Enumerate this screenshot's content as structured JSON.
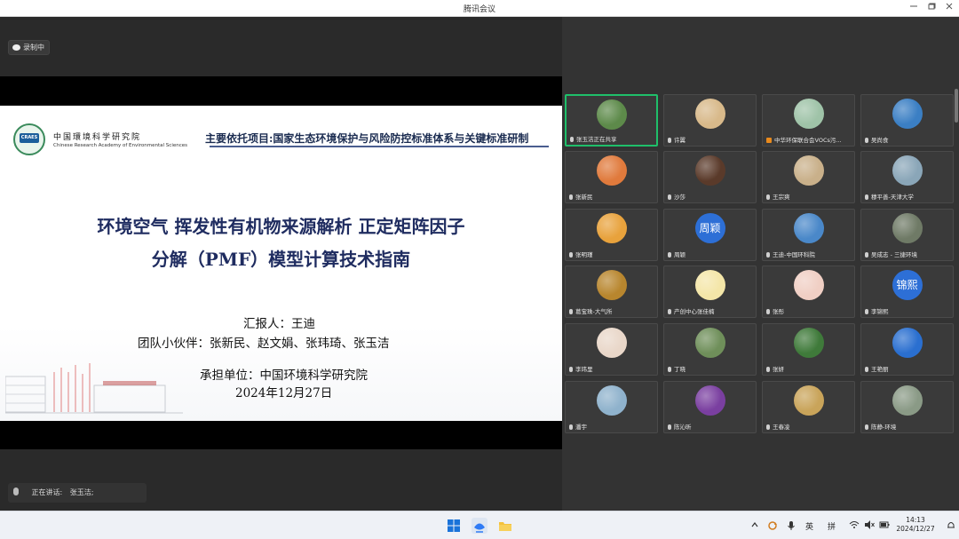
{
  "window": {
    "title": "腾讯会议"
  },
  "recording": {
    "label": "录制中"
  },
  "slide": {
    "org_cn": "中国環境科学研究院",
    "org_en": "Chinese Research Academy of Environmental Sciences",
    "logo_text": "CRAES",
    "project": "主要依托项目:国家生态环境保护与风险防控标准体系与关键标准研制",
    "title_line1": "环境空气 挥发性有机物来源解析 正定矩阵因子",
    "title_line2": "分解（PMF）模型计算技术指南",
    "reporter": "汇报人：王迪",
    "team": "团队小伙伴：张新民、赵文娟、张玮琦、张玉洁",
    "unit": "承担单位：中国环境科学研究院",
    "date": "2024年12月27日"
  },
  "speaking": {
    "label": "正在讲话:",
    "name": "张玉洁;"
  },
  "participants": [
    {
      "name": "张玉洁正在共享",
      "avatar": "photo",
      "color": "#5d8a4a",
      "active": true
    },
    {
      "name": "许翼",
      "avatar": "photo",
      "color": "#d8b98a"
    },
    {
      "name": "中华环保联合会VOCs污...",
      "avatar": "photo",
      "color": "#9fc3a8",
      "orange": true
    },
    {
      "name": "吴尚食",
      "avatar": "photo",
      "color": "#3b7fc4"
    },
    {
      "name": "张新民",
      "avatar": "photo",
      "color": "#e07a3c"
    },
    {
      "name": "沙莎",
      "avatar": "photo",
      "color": "#5a3a2a"
    },
    {
      "name": "王宗爽",
      "avatar": "photo",
      "color": "#c9b08a"
    },
    {
      "name": "穆平善-天津大学",
      "avatar": "photo",
      "color": "#8aa6b8"
    },
    {
      "name": "张明瑾",
      "avatar": "photo",
      "color": "#e8a23c"
    },
    {
      "name": "周颖",
      "avatar": "text",
      "text": "周颖"
    },
    {
      "name": "王迪-中国环科院",
      "avatar": "photo",
      "color": "#4a88c9"
    },
    {
      "name": "吴成志 - 三捷环境",
      "avatar": "photo",
      "color": "#6f7a66"
    },
    {
      "name": "葛宝珠-大气所",
      "avatar": "photo",
      "color": "#b8862e"
    },
    {
      "name": "产创中心张佳楠",
      "avatar": "photo",
      "color": "#f4e6a8"
    },
    {
      "name": "张彤",
      "avatar": "photo",
      "color": "#f0cfc4"
    },
    {
      "name": "李锦熙",
      "avatar": "text",
      "text": "锦熙"
    },
    {
      "name": "李玮里",
      "avatar": "photo",
      "color": "#e9d7c9"
    },
    {
      "name": "丁晓",
      "avatar": "photo",
      "color": "#6f8f5a"
    },
    {
      "name": "张妍",
      "avatar": "photo",
      "color": "#3f7a3a"
    },
    {
      "name": "王艳丽",
      "avatar": "photo",
      "color": "#2a6fd0"
    },
    {
      "name": "潘宇",
      "avatar": "photo",
      "color": "#8fb2cc"
    },
    {
      "name": "陈沁昕",
      "avatar": "photo",
      "color": "#7a3fa0"
    },
    {
      "name": "王春凌",
      "avatar": "photo",
      "color": "#c9a45a"
    },
    {
      "name": "陈静-环境",
      "avatar": "photo",
      "color": "#8a9a86"
    }
  ],
  "taskbar": {
    "ime_lang": "英",
    "ime_mode": "拼",
    "time": "14:13",
    "date": "2024/12/27"
  }
}
